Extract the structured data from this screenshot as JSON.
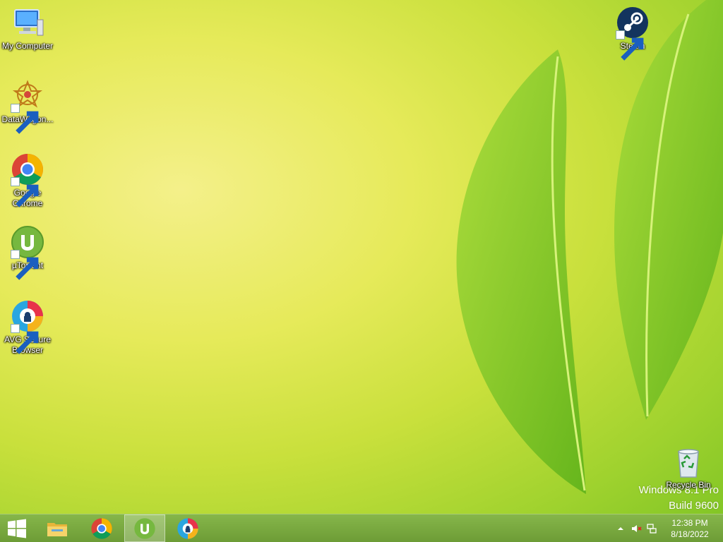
{
  "desktop": {
    "icons": [
      {
        "label": "My Computer",
        "icon": "computer-icon"
      },
      {
        "label": "DataWagon...",
        "icon": "datawagon-icon"
      },
      {
        "label": "Google Chrome",
        "icon": "chrome-icon"
      },
      {
        "label": "µTorrent",
        "icon": "utorrent-icon"
      },
      {
        "label": "AVG Secure Browser",
        "icon": "avg-browser-icon"
      },
      {
        "label": "Steam",
        "icon": "steam-icon"
      },
      {
        "label": "Recycle Bin",
        "icon": "recycle-bin-icon"
      }
    ],
    "watermark": {
      "line1": "Windows 8.1 Pro",
      "line2": "Build 9600"
    }
  },
  "taskbar": {
    "pinned": [
      {
        "name": "file-explorer",
        "icon": "folder-icon"
      },
      {
        "name": "chrome",
        "icon": "chrome-icon"
      },
      {
        "name": "utorrent",
        "icon": "utorrent-icon",
        "active": true
      },
      {
        "name": "avg-browser",
        "icon": "avg-browser-icon"
      }
    ],
    "tray": {
      "time": "12:38 PM",
      "date": "8/18/2022"
    }
  },
  "colors": {
    "taskbar": "#7aa93f",
    "wallpaper_green": "#9fd22e",
    "wallpaper_yellow": "#f4f08a"
  }
}
